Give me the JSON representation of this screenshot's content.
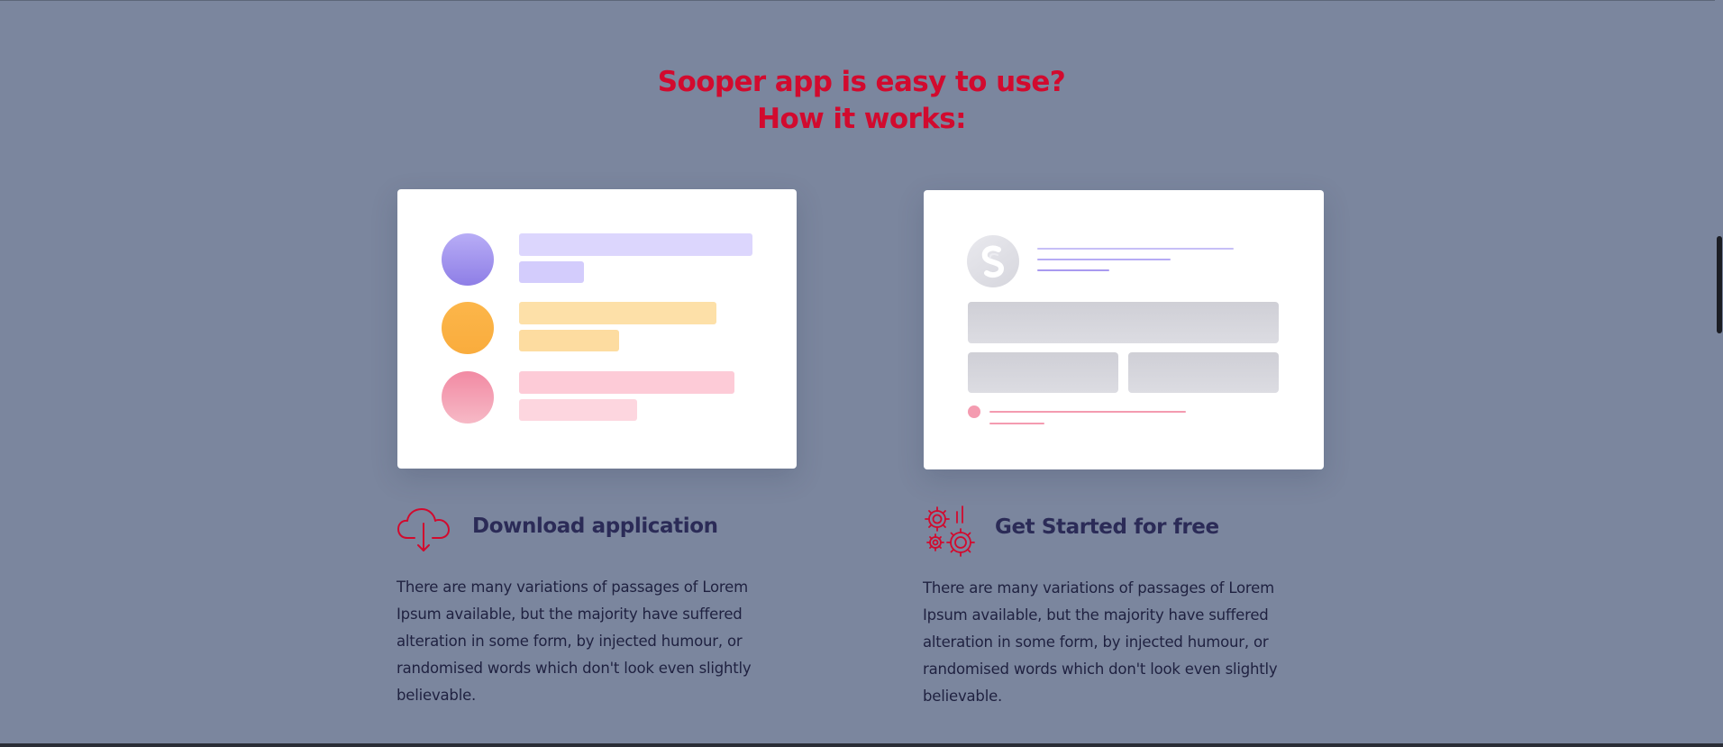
{
  "section": {
    "title_line1": "Sooper app is easy to use?",
    "title_line2": "How it works:"
  },
  "features": [
    {
      "icon": "cloud-download-icon",
      "title": "Download application",
      "text": "There are many variations of passages of Lorem Ipsum available, but the majority have suffered alteration in some form, by injected humour, or randomised words which don't look even slightly believable."
    },
    {
      "icon": "gears-icon",
      "title": "Get Started for free",
      "text": "There are many variations of passages of Lorem Ipsum available, but the majority have suffered alteration in some form, by injected humour, or randomised words which don't look even slightly believable."
    }
  ],
  "colors": {
    "accent": "#d20a2e",
    "background": "#7b869e",
    "title_text": "#2b2b57",
    "purple": "#a89af0",
    "orange": "#fbb140",
    "pink": "#f49bb0"
  },
  "illustrations": {
    "left_card": "app-list-illustration",
    "right_card": "app-profile-illustration",
    "logo": "sooper-s-logo-icon"
  }
}
